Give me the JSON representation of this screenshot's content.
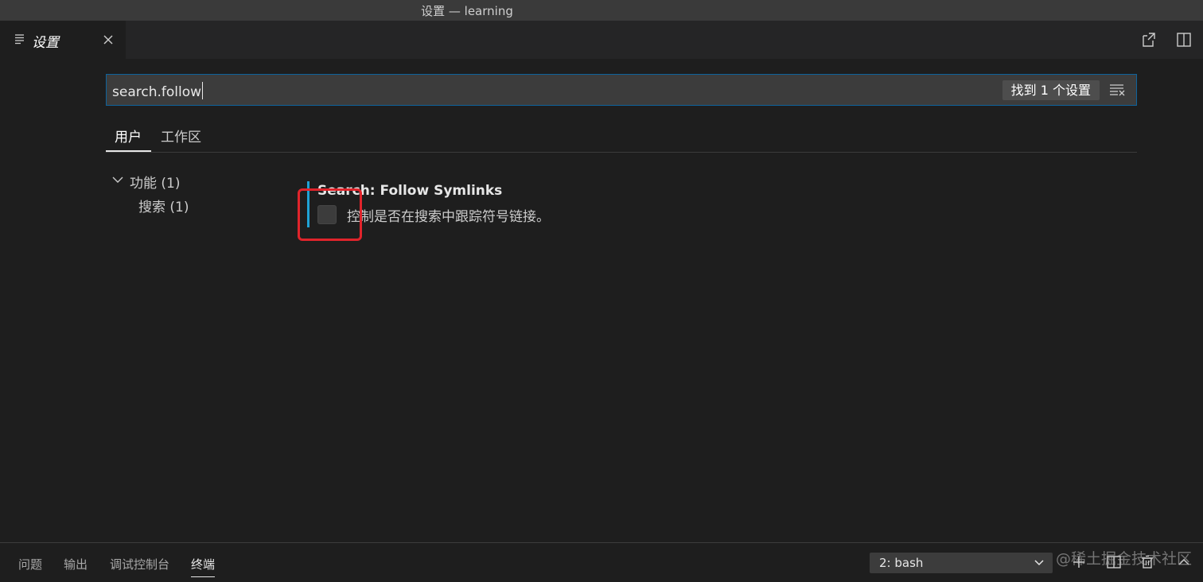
{
  "window": {
    "title": "设置 — learning"
  },
  "editor_tab": {
    "label": "设置",
    "icon": "settings-list-icon",
    "close_icon": "close-icon"
  },
  "editor_actions": [
    {
      "name": "open-settings-json-icon"
    },
    {
      "name": "split-editor-icon"
    }
  ],
  "search": {
    "value": "search.follow",
    "result_count": "找到 1 个设置",
    "clear_icon": "clear-filter-icon"
  },
  "scope_tabs": {
    "user": "用户",
    "workspace": "工作区",
    "active": "用户"
  },
  "toc": {
    "group_label": "功能 (1)",
    "child_label": "搜索 (1)"
  },
  "setting": {
    "title": "Search: Follow Symlinks",
    "description": "控制是否在搜索中跟踪符号链接。",
    "checked": false
  },
  "panel": {
    "tabs": [
      "问题",
      "输出",
      "调试控制台",
      "终端"
    ],
    "active_tab": "终端",
    "terminal_selected": "2: bash",
    "icons": [
      "add-terminal-icon",
      "split-terminal-icon",
      "trash-icon",
      "chevron-up-icon"
    ]
  },
  "watermark": "@稀土掘金技术社区",
  "colors": {
    "accent": "#1fa2d6",
    "highlight": "#e0242b",
    "search_border": "#0e639c"
  }
}
